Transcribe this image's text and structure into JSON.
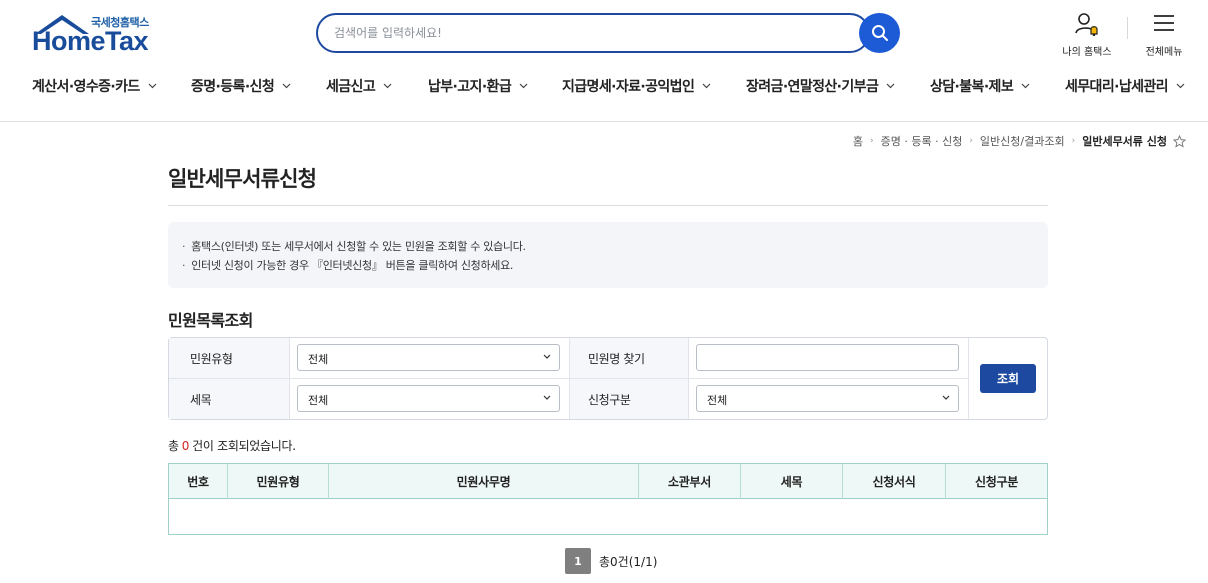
{
  "header": {
    "logo_sub": "국세청홈택스",
    "logo_main": "HomeTax",
    "search_placeholder": "검색어를 입력하세요!",
    "my_hometax": "나의 홈택스",
    "all_menu": "전체메뉴"
  },
  "gnb": [
    {
      "label": "계산서·영수증·카드"
    },
    {
      "label": "증명·등록·신청"
    },
    {
      "label": "세금신고"
    },
    {
      "label": "납부·고지·환급"
    },
    {
      "label": "지급명세·자료·공익법인"
    },
    {
      "label": "장려금·연말정산·기부금"
    },
    {
      "label": "상담·불복·제보"
    },
    {
      "label": "세무대리·납세관리"
    }
  ],
  "breadcrumb": [
    "홈",
    "증명 · 등록 · 신청",
    "일반신청/결과조회",
    "일반세무서류 신청"
  ],
  "page_title": "일반세무서류신청",
  "notice": [
    "홈택스(인터넷) 또는 세무서에서 신청할 수 있는 민원을 조회할 수 있습니다.",
    "인터넷 신청이 가능한 경우 『인터넷신청』 버튼을 클릭하여 신청하세요."
  ],
  "section_title": "민원목록조회",
  "filters": {
    "type_label": "민원유형",
    "type_value": "전체",
    "name_label": "민원명 찾기",
    "name_value": "",
    "tax_label": "세목",
    "tax_value": "전체",
    "apply_label": "신청구분",
    "apply_value": "전체",
    "search_button": "조회"
  },
  "result": {
    "prefix": "총",
    "count": "0",
    "suffix": "건이 조회되었습니다."
  },
  "table": {
    "columns": [
      "번호",
      "민원유형",
      "민원사무명",
      "소관부서",
      "세목",
      "신청서식",
      "신청구분"
    ],
    "rows": []
  },
  "pagination": {
    "current": "1",
    "total_text": "총0건(1/1)"
  },
  "colors": {
    "primary": "#1d4aa0",
    "search_button": "#1d5bd6",
    "count_highlight": "#d2261f",
    "table_header_bg": "#eef8f6",
    "table_border": "#9ed2c8"
  }
}
